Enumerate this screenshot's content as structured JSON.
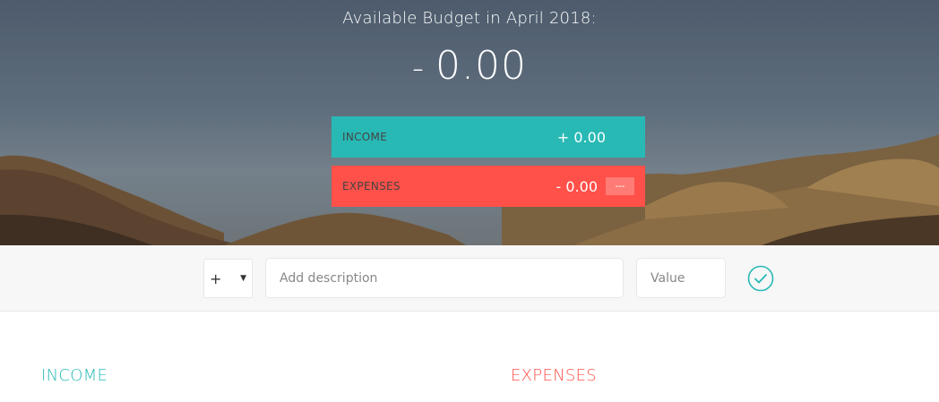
{
  "header": {
    "title": "Available Budget in April 2018:",
    "budget_sign": "-",
    "budget_value": "0.00"
  },
  "summary": {
    "income": {
      "label": "Income",
      "value": "+ 0.00"
    },
    "expenses": {
      "label": "Expenses",
      "value": "- 0.00",
      "percentage": "---"
    }
  },
  "add_bar": {
    "type_value": "+",
    "type_options": [
      "+",
      "-"
    ],
    "description_placeholder": "Add description",
    "value_placeholder": "Value",
    "submit_icon": "check-circle-icon"
  },
  "lists": {
    "income_title": "Income",
    "expenses_title": "Expenses"
  },
  "colors": {
    "income": "#28b9b5",
    "expenses": "#ff5049"
  }
}
